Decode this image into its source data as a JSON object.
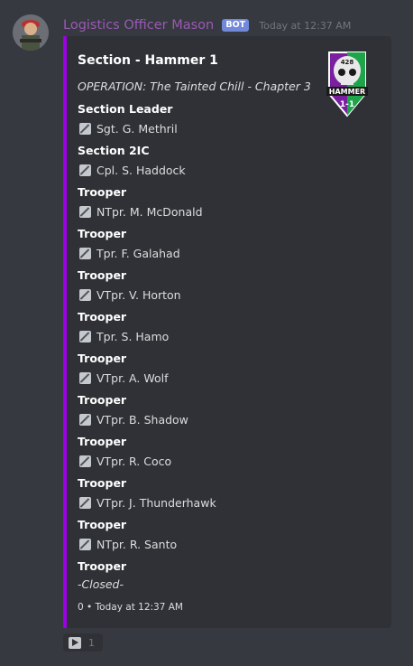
{
  "message": {
    "author": "Logistics Officer Mason",
    "bot_tag": "BOT",
    "timestamp": "Today at 12:37 AM"
  },
  "embed": {
    "accent_color": "#9b00e6",
    "title": "Section - Hammer 1",
    "description": "OPERATION: The Tainted Chill - Chapter 3",
    "thumbnail": {
      "icon": "hammer-skull-logo",
      "text_top": "428",
      "text_mid": "HAMMER",
      "text_bottom": "1-1"
    },
    "fields": [
      {
        "name": "Section Leader",
        "value": "Sgt. G. Methril",
        "icon": "slash-box-icon"
      },
      {
        "name": "Section 2IC",
        "value": "Cpl. S. Haddock",
        "icon": "slash-box-icon"
      },
      {
        "name": "Trooper",
        "value": "NTpr. M. McDonald",
        "icon": "slash-box-icon"
      },
      {
        "name": "Trooper",
        "value": "Tpr. F. Galahad",
        "icon": "slash-box-icon"
      },
      {
        "name": "Trooper",
        "value": "VTpr. V. Horton",
        "icon": "slash-box-icon"
      },
      {
        "name": "Trooper",
        "value": "Tpr. S. Hamo",
        "icon": "slash-box-icon"
      },
      {
        "name": "Trooper",
        "value": "VTpr. A. Wolf",
        "icon": "slash-box-icon"
      },
      {
        "name": "Trooper",
        "value": "VTpr. B. Shadow",
        "icon": "slash-box-icon"
      },
      {
        "name": "Trooper",
        "value": "VTpr. R. Coco",
        "icon": "slash-box-icon"
      },
      {
        "name": "Trooper",
        "value": "VTpr. J. Thunderhawk",
        "icon": "slash-box-icon"
      },
      {
        "name": "Trooper",
        "value": "NTpr. R. Santo",
        "icon": "slash-box-icon"
      },
      {
        "name": "Trooper",
        "value": "-Closed-",
        "icon": ""
      }
    ],
    "footer": "0 • Today at 12:37 AM"
  },
  "reaction": {
    "emoji": "play-button-icon",
    "count": "1"
  }
}
